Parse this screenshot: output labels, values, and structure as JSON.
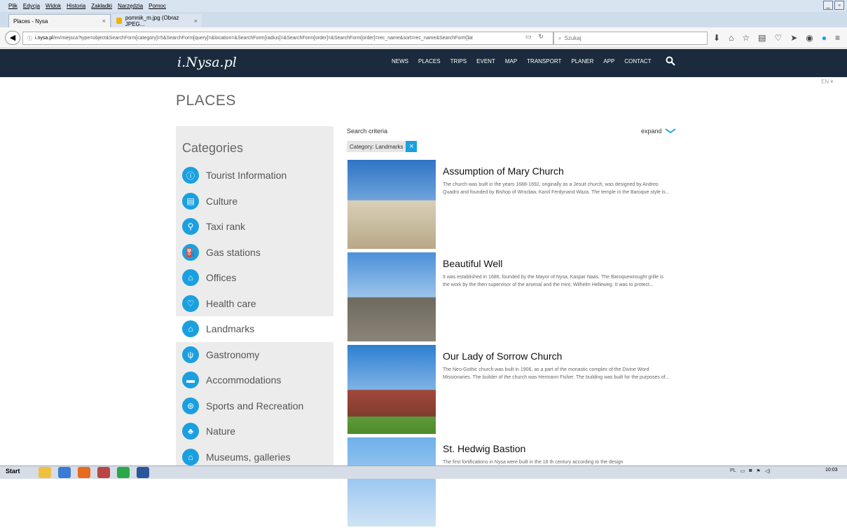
{
  "menu": [
    "Plik",
    "Edycja",
    "Widok",
    "Historia",
    "Zakładki",
    "Narzędzia",
    "Pomoc"
  ],
  "tabs": [
    {
      "label": "Places - Nysa",
      "active": true
    },
    {
      "label": "pomnik_m.jpg (Obraz JPEG...",
      "active": false
    }
  ],
  "url": {
    "host": "i.nysa.pl",
    "path": "/en/miejsca?type=object&SearchForm[category]=5&SearchForm[query]=&location=&SearchForm[radius]=&SearchForm[order]=&SearchForm[order]=rec_name&sort=rec_name&SearchForm[lat"
  },
  "search_placeholder": "Szukaj",
  "site": {
    "logo": "i.Nysa.pl",
    "nav": [
      "NEWS",
      "PLACES",
      "TRIPS",
      "EVENT",
      "MAP",
      "TRANSPORT",
      "PLANER",
      "APP",
      "CONTACT"
    ],
    "lang": "EN"
  },
  "page_title": "PLACES",
  "categories_heading": "Categories",
  "categories": [
    {
      "label": "Tourist Information",
      "icon": "info-icon",
      "glyph": "ⓘ"
    },
    {
      "label": "Culture",
      "icon": "culture-icon",
      "glyph": "▤"
    },
    {
      "label": "Taxi rank",
      "icon": "taxi-icon",
      "glyph": "⚲"
    },
    {
      "label": "Gas stations",
      "icon": "gas-icon",
      "glyph": "⛽"
    },
    {
      "label": "Offices",
      "icon": "office-icon",
      "glyph": "⌂"
    },
    {
      "label": "Health care",
      "icon": "health-icon",
      "glyph": "♡"
    },
    {
      "label": "Landmarks",
      "icon": "landmark-icon",
      "glyph": "⌂",
      "selected": true
    },
    {
      "label": "Gastronomy",
      "icon": "food-icon",
      "glyph": "ψ"
    },
    {
      "label": "Accommodations",
      "icon": "bed-icon",
      "glyph": "▬"
    },
    {
      "label": "Sports and Recreation",
      "icon": "sports-icon",
      "glyph": "⊛"
    },
    {
      "label": "Nature",
      "icon": "tree-icon",
      "glyph": "♣"
    },
    {
      "label": "Museums, galleries",
      "icon": "museum-icon",
      "glyph": "⌂"
    }
  ],
  "search_criteria": "Search criteria",
  "expand": "expand",
  "filter_label": "Category: Landmarks",
  "places": [
    {
      "title": "Assumption of Mary Church",
      "desc": "The church was built in the years 1688-1692, originally as a Jesuit church, was designed by Andreo Quadro and founded by Bishop of Wrocław, Karol Ferdynand Waza. The temple in the Baroque style is..."
    },
    {
      "title": "Beautiful Well",
      "desc": "It was established in 1686, founded by the Mayor of Nysa, Kaspar Naas. The Baroquewrought grille is the work by the then supervisor of the arsenal and the mint, Wilhelm Helleweg. It was to protect..."
    },
    {
      "title": "Our Lady of Sorrow Church",
      "desc": "The Neo-Gothic church was built in 1906, as a part of the monastic complex of the Divine Word Missionaries. The builder of the church was Hermann Fisher. The building was built for the purposes of..."
    },
    {
      "title": "St. Hedwig Bastion",
      "desc": "The first fortifications in Nysa were built in the 16 th century according to the design"
    }
  ],
  "taskbar": {
    "start": "Start",
    "lang": "PL",
    "time": "10:03"
  }
}
